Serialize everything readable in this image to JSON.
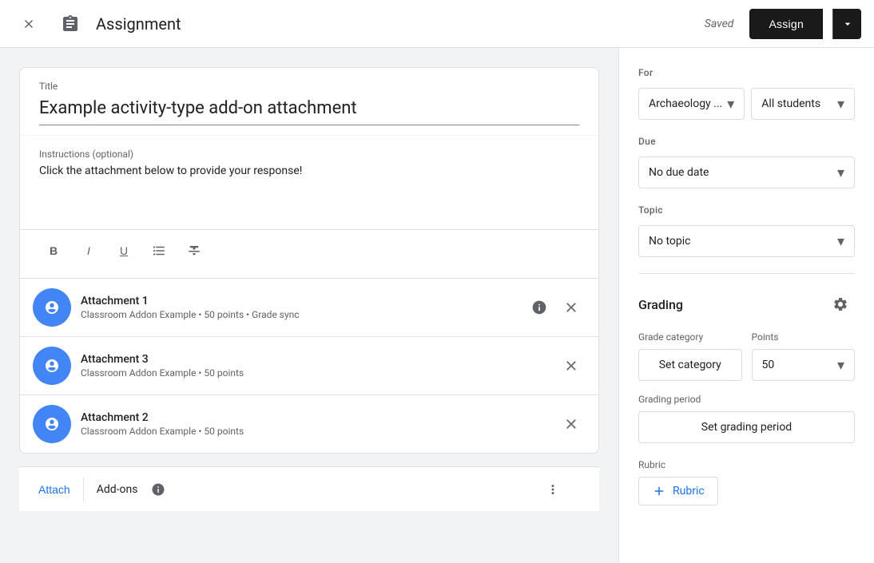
{
  "topbar": {
    "title": "Assignment",
    "saved_label": "Saved",
    "assign_label": "Assign"
  },
  "left": {
    "title_label": "Title",
    "title_value": "Example activity-type add-on attachment",
    "instructions_label": "Instructions (optional)",
    "instructions_value": "Click the attachment below to provide your response!",
    "toolbar_buttons": [
      "B",
      "I",
      "U",
      "≡",
      "S"
    ],
    "attachments": [
      {
        "name": "Attachment 1",
        "meta": "Classroom Addon Example • 50 points • Grade sync",
        "has_info": true
      },
      {
        "name": "Attachment 3",
        "meta": "Classroom Addon Example • 50 points",
        "has_info": false
      },
      {
        "name": "Attachment 2",
        "meta": "Classroom Addon Example • 50 points",
        "has_info": false
      }
    ],
    "bottom_attach": "Attach",
    "bottom_addons": "Add-ons"
  },
  "right": {
    "for_label": "For",
    "class_value": "Archaeology ...",
    "students_value": "All students",
    "due_label": "Due",
    "due_value": "No due date",
    "topic_label": "Topic",
    "topic_value": "No topic",
    "grading_title": "Grading",
    "grade_category_label": "Grade category",
    "points_label": "Points",
    "set_category_label": "Set category",
    "points_value": "50",
    "grading_period_label": "Grading period",
    "set_grading_period_label": "Set grading period",
    "rubric_label": "Rubric",
    "add_rubric_label": "Rubric"
  }
}
